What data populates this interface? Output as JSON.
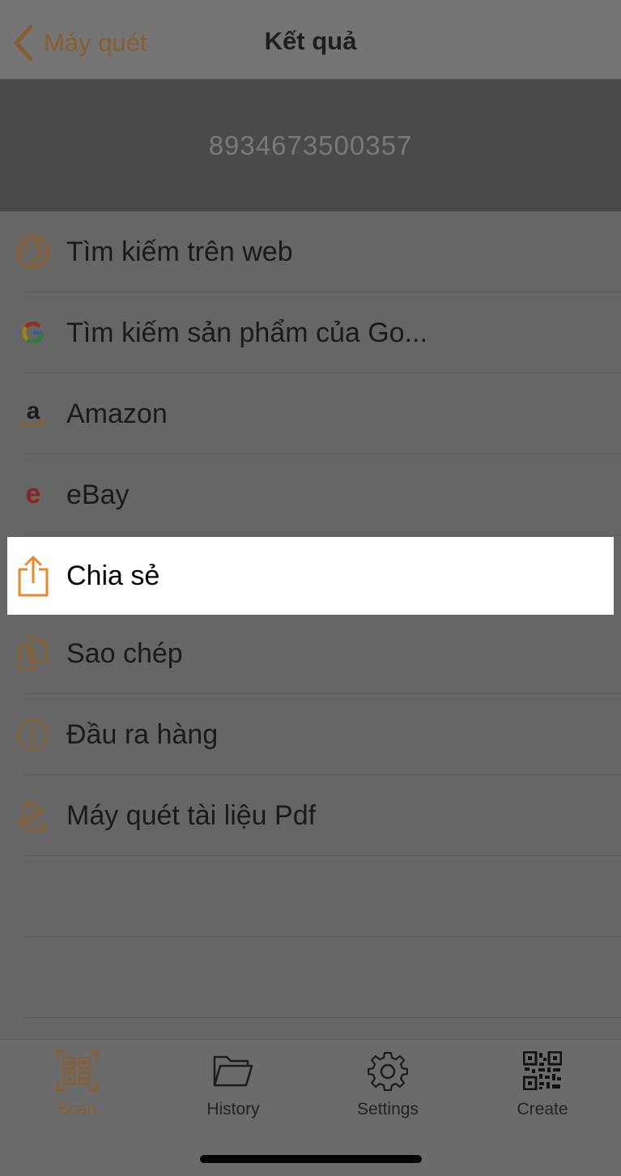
{
  "navbar": {
    "back_label": "Máy quét",
    "title": "Kết quả"
  },
  "scan_result": {
    "code": "8934673500357"
  },
  "actions": [
    {
      "label": "Tìm kiếm trên web",
      "icon": "globe-icon"
    },
    {
      "label": "Tìm kiếm sản phẩm của Go...",
      "icon": "google-icon"
    },
    {
      "label": "Amazon",
      "icon": "amazon-icon"
    },
    {
      "label": "eBay",
      "icon": "ebay-icon"
    },
    {
      "label": "Chia sẻ",
      "icon": "share-icon",
      "highlighted": true
    },
    {
      "label": "Sao chép",
      "icon": "copy-icon"
    },
    {
      "label": "Đầu ra hàng",
      "icon": "info-icon"
    },
    {
      "label": "Máy quét tài liệu Pdf",
      "icon": "document-scanner-icon"
    }
  ],
  "tabbar": {
    "tabs": [
      {
        "label": "Scan",
        "icon": "qr-scan-icon",
        "active": true
      },
      {
        "label": "History",
        "icon": "folder-icon"
      },
      {
        "label": "Settings",
        "icon": "gear-icon"
      },
      {
        "label": "Create",
        "icon": "qr-code-icon"
      }
    ]
  },
  "colors": {
    "accent": "#e8882a",
    "accent_dimmed": "#8a5d2f",
    "overlay_background": "#666666",
    "banner_background": "#4a4a4a",
    "highlight_background": "#ffffff"
  }
}
